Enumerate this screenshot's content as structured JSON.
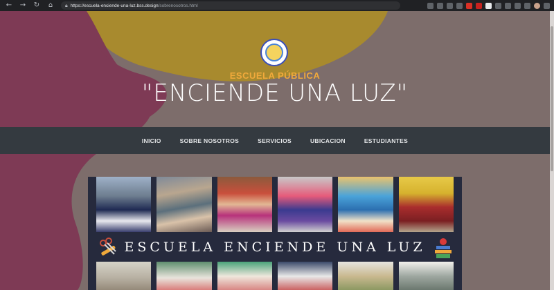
{
  "browser": {
    "url_host": "https://escuela-enciende-una-luz.bss.design",
    "url_path": "/sobrenosotros.html"
  },
  "hero": {
    "school_type": "ESCUELA PÚBLICA",
    "school_name": "\"ENCIENDE UNA LUZ\""
  },
  "nav": {
    "items": [
      "INICIO",
      "SOBRE NOSOTROS",
      "SERVICIOS",
      "UBICACION",
      "ESTUDIANTES"
    ]
  },
  "banner": {
    "title": "ESCUELA ENCIENDE UNA LUZ"
  },
  "colors": {
    "background": "#7d6d6b",
    "blob_magenta": "#7e3a55",
    "blob_gold": "#a88a2e",
    "accent": "#f0a93b",
    "navbar": "#343a40"
  }
}
